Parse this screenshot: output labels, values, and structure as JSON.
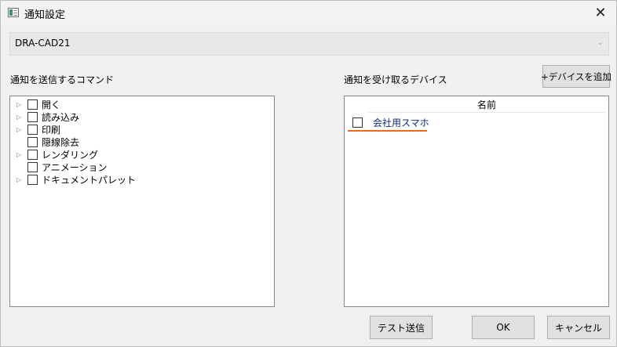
{
  "window": {
    "title": "通知設定",
    "close_glyph": "✕"
  },
  "app_select": {
    "value": "DRA-CAD21",
    "chevron": "⌄"
  },
  "commands": {
    "label": "通知を送信するコマンド",
    "items": [
      {
        "label": "開く",
        "expandable": true,
        "checked": false
      },
      {
        "label": "読み込み",
        "expandable": true,
        "checked": false
      },
      {
        "label": "印刷",
        "expandable": true,
        "checked": false
      },
      {
        "label": "隠線除去",
        "expandable": false,
        "checked": false
      },
      {
        "label": "レンダリング",
        "expandable": true,
        "checked": false
      },
      {
        "label": "アニメーション",
        "expandable": false,
        "checked": false
      },
      {
        "label": "ドキュメントパレット",
        "expandable": true,
        "checked": false
      }
    ]
  },
  "devices": {
    "label": "通知を受け取るデバイス",
    "add_button": "+デバイスを追加",
    "column_header": "名前",
    "rows": [
      {
        "name": "会社用スマホ",
        "checked": false
      }
    ]
  },
  "footer": {
    "test_label": "テスト送信",
    "ok_label": "OK",
    "cancel_label": "キャンセル"
  },
  "colors": {
    "accent_underline": "#f06a18",
    "device_text": "#0b2a82"
  }
}
